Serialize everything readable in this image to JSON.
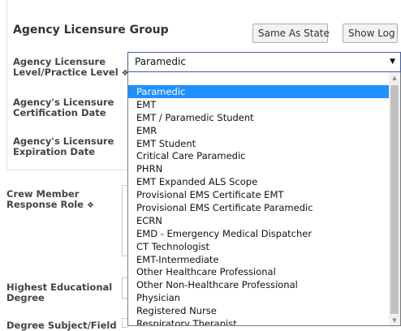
{
  "group": {
    "title": "Agency Licensure Group"
  },
  "buttons": {
    "same_as_state": "Same As State",
    "show_log": "Show Log"
  },
  "labels": {
    "licensure_level_line1": "Agency Licensure",
    "licensure_level_line2": "Level/Practice Level",
    "certification_date_line1": "Agency's Licensure",
    "certification_date_line2": "Certification Date",
    "expiration_date_line1": "Agency's Licensure",
    "expiration_date_line2": "Expiration Date",
    "crew_role_line1": "Crew Member",
    "crew_role_line2": "Response Role",
    "education_line1": "Highest Educational",
    "education_line2": "Degree",
    "degree_subject_partial": "Degree Subject/Field"
  },
  "icons": {
    "info": "info-circle-icon",
    "dropdown": "caret-down-icon"
  },
  "select": {
    "selected_value": "Paramedic",
    "options": [
      "Paramedic",
      "EMT",
      "EMT / Paramedic Student",
      "EMR",
      "EMT Student",
      "Critical Care Paramedic",
      "PHRN",
      "EMT Expanded ALS Scope",
      "Provisional EMS Certificate EMT",
      "Provisional EMS Certificate Paramedic",
      "ECRN",
      "EMD - Emergency Medical Dispatcher",
      "CT Technologist",
      "EMT-Intermediate",
      "Other Healthcare Professional",
      "Other Non-Healthcare Professional",
      "Physician",
      "Registered Nurse",
      "Respiratory Therapist"
    ]
  },
  "colors": {
    "selected_highlight": "#1e90ff",
    "select_border": "#3d5ea8"
  }
}
